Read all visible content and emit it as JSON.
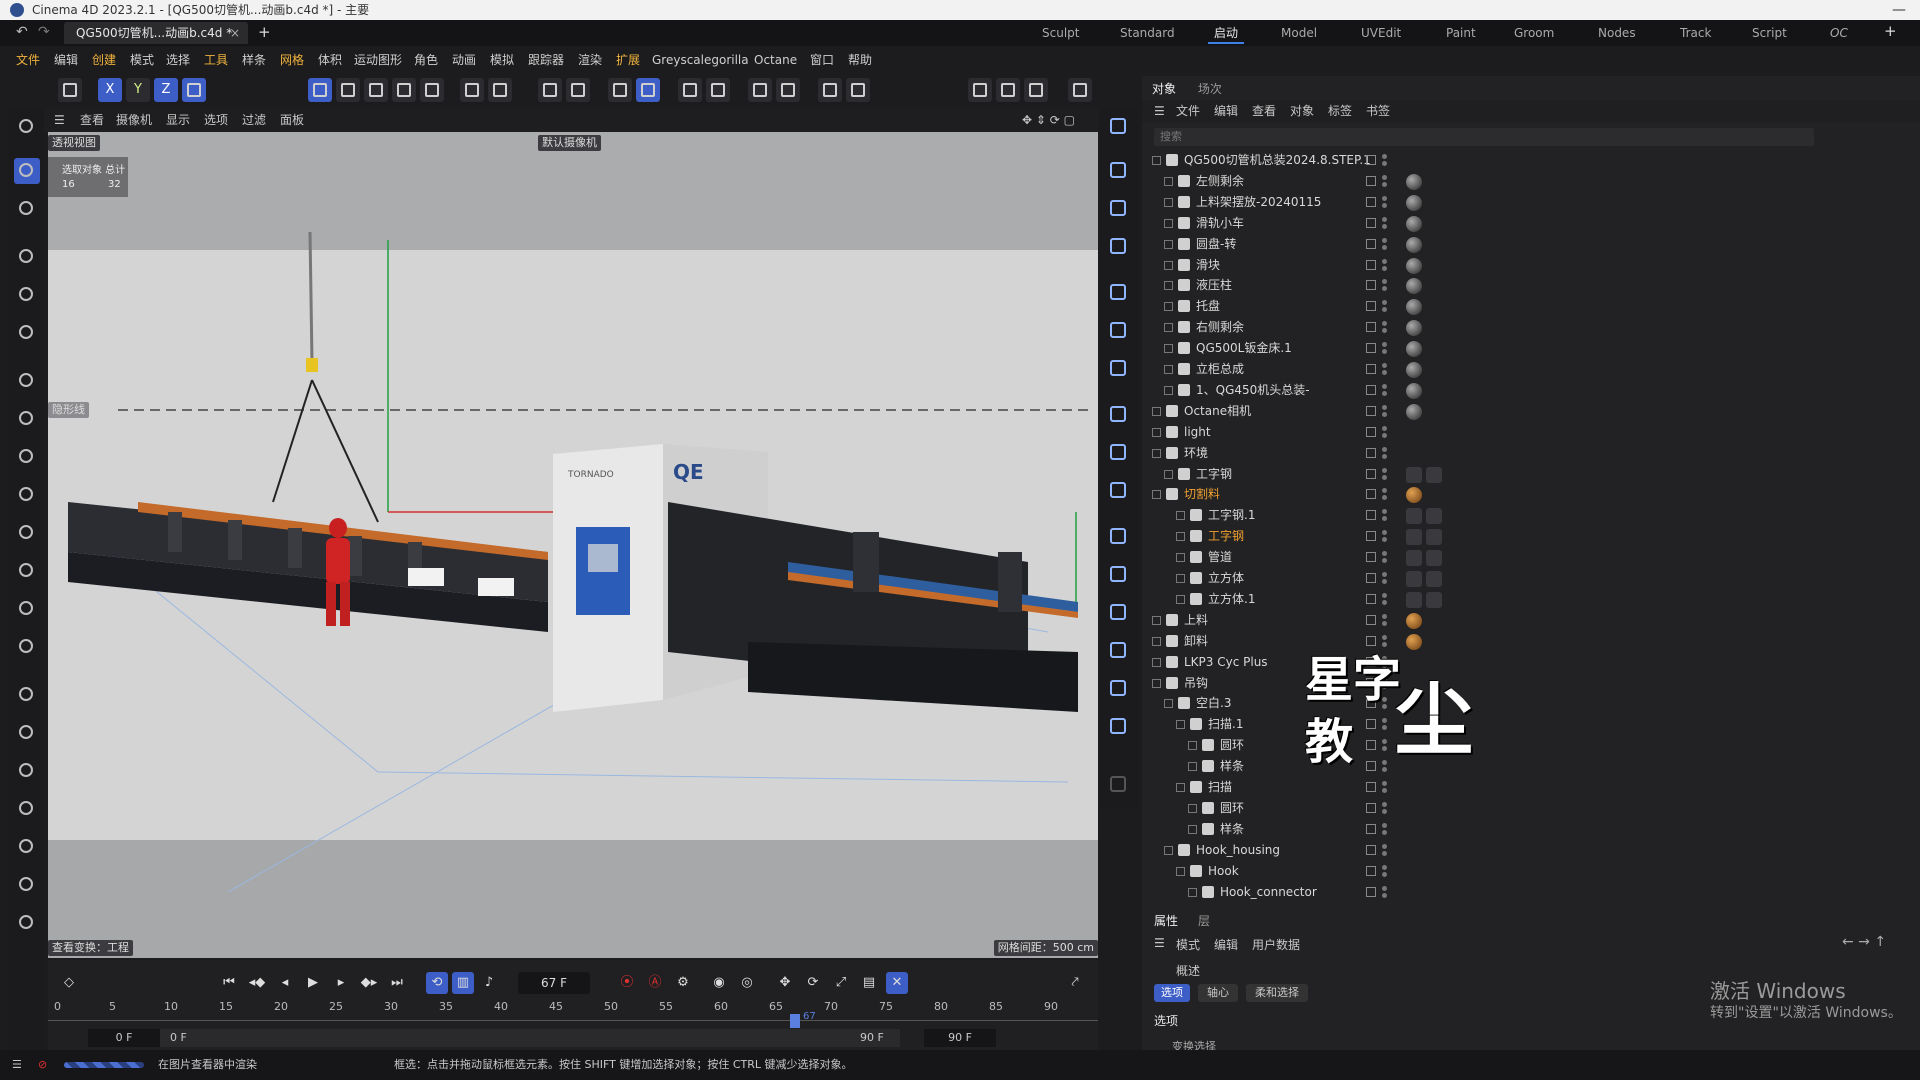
{
  "window": {
    "title": "Cinema 4D 2023.2.1 - [QG500切管机...动画b.c4d *] - 主要",
    "minimize": "—"
  },
  "tabs": {
    "doc_tab": "QG500切管机...动画b.c4d *",
    "close": "×",
    "add": "+"
  },
  "layouts": [
    "Sculpt",
    "Standard",
    "启动",
    "Model",
    "UVEdit",
    "Paint",
    "Groom",
    "Nodes",
    "Track",
    "Script",
    "OC"
  ],
  "active_layout": "启动",
  "menu": [
    "文件",
    "编辑",
    "创建",
    "模式",
    "选择",
    "工具",
    "样条",
    "网格",
    "体积",
    "运动图形",
    "角色",
    "动画",
    "模拟",
    "跟踪器",
    "渲染",
    "扩展",
    "Greyscalegorilla",
    "Octane",
    "窗口",
    "帮助"
  ],
  "viewport": {
    "menu": [
      "查看",
      "摄像机",
      "显示",
      "选项",
      "过滤",
      "面板"
    ],
    "label": "透视视图",
    "camera": "默认摄像机",
    "hud_title": "选取对象 总计",
    "hud_a": "16",
    "hud_b": "32",
    "left_badge": "隐形线",
    "bottom_left": "查看变换：工程",
    "bottom_right": "网格间距：500 cm",
    "machine_brand": "QE",
    "machine_sub": "TORNADO"
  },
  "object_manager": {
    "tabs": [
      "对象",
      "场次"
    ],
    "menu": [
      "文件",
      "编辑",
      "查看",
      "对象",
      "标签",
      "书签"
    ],
    "search_placeholder": "搜索",
    "rows": [
      {
        "name": "QG500切管机总装2024.8.STEP.1",
        "indent": 0,
        "color": ""
      },
      {
        "name": "左侧剩余",
        "indent": 1,
        "color": ""
      },
      {
        "name": "上料架摆放-20240115",
        "indent": 1,
        "color": ""
      },
      {
        "name": "滑轨小车",
        "indent": 1,
        "color": ""
      },
      {
        "name": "圆盘-转",
        "indent": 1,
        "color": ""
      },
      {
        "name": "滑块",
        "indent": 1,
        "color": ""
      },
      {
        "name": "液压柱",
        "indent": 1,
        "color": ""
      },
      {
        "name": "托盘",
        "indent": 1,
        "color": ""
      },
      {
        "name": "右侧剩余",
        "indent": 1,
        "color": ""
      },
      {
        "name": "QG500L钣金床.1",
        "indent": 1,
        "color": ""
      },
      {
        "name": "立柜总成",
        "indent": 1,
        "color": ""
      },
      {
        "name": "1、QG450机头总装-",
        "indent": 1,
        "color": ""
      },
      {
        "name": "Octane相机",
        "indent": 0,
        "color": ""
      },
      {
        "name": "light",
        "indent": 0,
        "color": ""
      },
      {
        "name": "环境",
        "indent": 0,
        "color": ""
      },
      {
        "name": "工字钢",
        "indent": 1,
        "color": ""
      },
      {
        "name": "切割料",
        "indent": 0,
        "color": "orange"
      },
      {
        "name": "工字钢.1",
        "indent": 2,
        "color": ""
      },
      {
        "name": "工字钢",
        "indent": 2,
        "color": "orange"
      },
      {
        "name": "管道",
        "indent": 2,
        "color": ""
      },
      {
        "name": "立方体",
        "indent": 2,
        "color": ""
      },
      {
        "name": "立方体.1",
        "indent": 2,
        "color": ""
      },
      {
        "name": "上料",
        "indent": 0,
        "color": ""
      },
      {
        "name": "卸料",
        "indent": 0,
        "color": ""
      },
      {
        "name": "LKP3 Cyc Plus",
        "indent": 0,
        "color": ""
      },
      {
        "name": "吊钩",
        "indent": 0,
        "color": ""
      },
      {
        "name": "空白.3",
        "indent": 1,
        "color": ""
      },
      {
        "name": "扫描.1",
        "indent": 2,
        "color": ""
      },
      {
        "name": "圆环",
        "indent": 3,
        "color": ""
      },
      {
        "name": "样条",
        "indent": 3,
        "color": ""
      },
      {
        "name": "扫描",
        "indent": 2,
        "color": ""
      },
      {
        "name": "圆环",
        "indent": 3,
        "color": ""
      },
      {
        "name": "样条",
        "indent": 3,
        "color": ""
      },
      {
        "name": "Hook_housing",
        "indent": 1,
        "color": ""
      },
      {
        "name": "Hook",
        "indent": 2,
        "color": ""
      },
      {
        "name": "Hook_connector",
        "indent": 3,
        "color": ""
      }
    ]
  },
  "attributes": {
    "tabs": [
      "属性",
      "层"
    ],
    "menu": [
      "模式",
      "编辑",
      "用户数据"
    ],
    "title": "概述",
    "sub_tabs": [
      "选项",
      "轴心",
      "柔和选择"
    ],
    "section": "选项",
    "extra": "变换选择"
  },
  "timeline": {
    "frame": "67 F",
    "start": "0 F",
    "start2": "0 F",
    "end": "90 F",
    "end2": "90 F",
    "ticks": [
      "0",
      "5",
      "10",
      "15",
      "20",
      "25",
      "30",
      "35",
      "40",
      "45",
      "50",
      "55",
      "60",
      "65",
      "70",
      "75",
      "80",
      "85",
      "90"
    ],
    "current": "67"
  },
  "status": {
    "left": "在图片查看器中渲染",
    "help": "框选：点击并拖动鼠标框选元素。按住 SHIFT 键增加选择对象；按住 CTRL 键减少选择对象。"
  },
  "watermark": {
    "line1": "激活 Windows",
    "line2": "转到\"设置\"以激活 Windows。"
  },
  "logo": {
    "a": "星字",
    "b": "教",
    "c": "尘"
  },
  "colors": {
    "accent": "#3d5ec7",
    "orange": "#f0a030",
    "selected_blue": "#3f7fe8"
  }
}
